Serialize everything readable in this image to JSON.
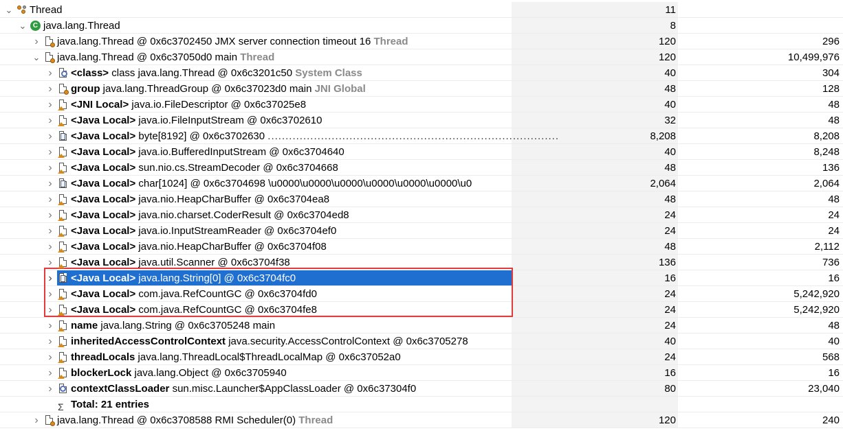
{
  "title_rows": [
    {
      "label": "Thread",
      "shallow": "11",
      "retained": ""
    },
    {
      "label": "java.lang.Thread",
      "shallow": "8",
      "retained": ""
    }
  ],
  "rows": [
    {
      "id": "r1",
      "indent": 2,
      "twisty": "›",
      "icon": "thread",
      "main": "java.lang.Thread @ 0x6c3702450  JMX server connection timeout 16",
      "tag": "Thread",
      "shallow": "120",
      "retained": "296"
    },
    {
      "id": "r2",
      "indent": 2,
      "twisty": "⌄",
      "icon": "thread",
      "main": "java.lang.Thread @ 0x6c37050d0  main",
      "tag": "Thread",
      "shallow": "120",
      "retained": "10,499,976"
    },
    {
      "id": "r3",
      "indent": 3,
      "twisty": "›",
      "icon": "class",
      "kw": "<class>",
      "main": "class java.lang.Thread @ 0x6c3201c50",
      "tag": "System Class",
      "shallow": "40",
      "retained": "304"
    },
    {
      "id": "r4",
      "indent": 3,
      "twisty": "›",
      "icon": "thread",
      "kw": "group",
      "main": "java.lang.ThreadGroup @ 0x6c37023d0  main",
      "tag": "JNI Global",
      "shallow": "48",
      "retained": "128"
    },
    {
      "id": "r5",
      "indent": 3,
      "twisty": "›",
      "icon": "doc",
      "kw": "<JNI Local>",
      "main": "java.io.FileDescriptor @ 0x6c37025e8",
      "shallow": "40",
      "retained": "48"
    },
    {
      "id": "r6",
      "indent": 3,
      "twisty": "›",
      "icon": "doc",
      "kw": "<Java Local>",
      "main": "java.io.FileInputStream @ 0x6c3702610",
      "shallow": "32",
      "retained": "48"
    },
    {
      "id": "r7",
      "indent": 3,
      "twisty": "›",
      "icon": "arr",
      "kw": "<Java Local>",
      "main": "byte[8192] @ 0x6c3702630",
      "dots": "..................................................................................",
      "shallow": "8,208",
      "retained": "8,208"
    },
    {
      "id": "r8",
      "indent": 3,
      "twisty": "›",
      "icon": "doc",
      "kw": "<Java Local>",
      "main": "java.io.BufferedInputStream @ 0x6c3704640",
      "shallow": "40",
      "retained": "8,248"
    },
    {
      "id": "r9",
      "indent": 3,
      "twisty": "›",
      "icon": "doc",
      "kw": "<Java Local>",
      "main": "sun.nio.cs.StreamDecoder @ 0x6c3704668",
      "shallow": "48",
      "retained": "136"
    },
    {
      "id": "r10",
      "indent": 3,
      "twisty": "›",
      "icon": "arr",
      "kw": "<Java Local>",
      "main": "char[1024] @ 0x6c3704698  \\u0000\\u0000\\u0000\\u0000\\u0000\\u0000\\u0",
      "shallow": "2,064",
      "retained": "2,064"
    },
    {
      "id": "r11",
      "indent": 3,
      "twisty": "›",
      "icon": "doc",
      "kw": "<Java Local>",
      "main": "java.nio.HeapCharBuffer @ 0x6c3704ea8",
      "shallow": "48",
      "retained": "48"
    },
    {
      "id": "r12",
      "indent": 3,
      "twisty": "›",
      "icon": "doc",
      "kw": "<Java Local>",
      "main": "java.nio.charset.CoderResult @ 0x6c3704ed8",
      "shallow": "24",
      "retained": "24"
    },
    {
      "id": "r13",
      "indent": 3,
      "twisty": "›",
      "icon": "doc",
      "kw": "<Java Local>",
      "main": "java.io.InputStreamReader @ 0x6c3704ef0",
      "shallow": "24",
      "retained": "24"
    },
    {
      "id": "r14",
      "indent": 3,
      "twisty": "›",
      "icon": "doc",
      "kw": "<Java Local>",
      "main": "java.nio.HeapCharBuffer @ 0x6c3704f08",
      "shallow": "48",
      "retained": "2,112"
    },
    {
      "id": "r15",
      "indent": 3,
      "twisty": "›",
      "icon": "doc",
      "kw": "<Java Local>",
      "main": "java.util.Scanner @ 0x6c3704f38",
      "shallow": "136",
      "retained": "736"
    },
    {
      "id": "r16",
      "indent": 3,
      "twisty": "›",
      "icon": "arr",
      "kw": "<Java Local>",
      "main": "java.lang.String[0] @ 0x6c3704fc0",
      "shallow": "16",
      "retained": "16",
      "selected": true
    },
    {
      "id": "r17",
      "indent": 3,
      "twisty": "›",
      "icon": "doc",
      "kw": "<Java Local>",
      "main": "com.java.RefCountGC @ 0x6c3704fd0",
      "shallow": "24",
      "retained": "5,242,920"
    },
    {
      "id": "r18",
      "indent": 3,
      "twisty": "›",
      "icon": "doc",
      "kw": "<Java Local>",
      "main": "com.java.RefCountGC @ 0x6c3704fe8",
      "shallow": "24",
      "retained": "5,242,920"
    },
    {
      "id": "r19",
      "indent": 3,
      "twisty": "›",
      "icon": "doc",
      "kw": "name",
      "main": "java.lang.String @ 0x6c3705248  main",
      "shallow": "24",
      "retained": "48"
    },
    {
      "id": "r20",
      "indent": 3,
      "twisty": "›",
      "icon": "doc",
      "kw": "inheritedAccessControlContext",
      "main": "java.security.AccessControlContext @ 0x6c3705278",
      "shallow": "40",
      "retained": "40"
    },
    {
      "id": "r21",
      "indent": 3,
      "twisty": "›",
      "icon": "doc",
      "kw": "threadLocals",
      "main": "java.lang.ThreadLocal$ThreadLocalMap @ 0x6c37052a0",
      "shallow": "24",
      "retained": "568"
    },
    {
      "id": "r22",
      "indent": 3,
      "twisty": "›",
      "icon": "doc",
      "kw": "blockerLock",
      "main": "java.lang.Object @ 0x6c3705940",
      "shallow": "16",
      "retained": "16"
    },
    {
      "id": "r23",
      "indent": 3,
      "twisty": "›",
      "icon": "objring",
      "kw": "contextClassLoader",
      "main": "sun.misc.Launcher$AppClassLoader @ 0x6c37304f0",
      "shallow": "80",
      "retained": "23,040"
    },
    {
      "id": "r24",
      "indent": 3,
      "twisty": "",
      "icon": "sigma",
      "kw": "Total: 21 entries",
      "main": "",
      "shallow": "",
      "retained": ""
    },
    {
      "id": "r25",
      "indent": 2,
      "twisty": "›",
      "icon": "thread",
      "main": "java.lang.Thread @ 0x6c3708588  RMI Scheduler(0)",
      "tag": "Thread",
      "shallow": "120",
      "retained": "240"
    }
  ],
  "colors": {
    "selection": "#1e6fd0",
    "redbox": "#e03a3a",
    "tag": "#8a8a8a"
  }
}
